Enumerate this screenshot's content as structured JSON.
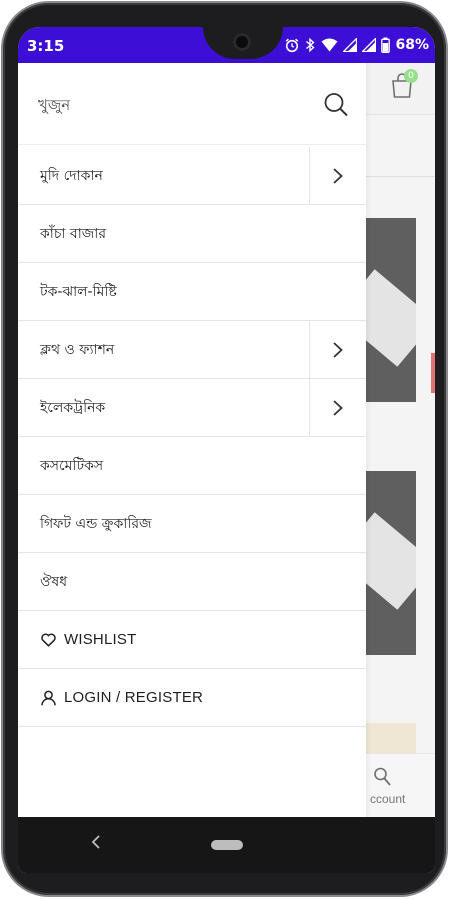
{
  "status_bar": {
    "time": "3:15",
    "battery_percent": "68%",
    "icons": [
      "alarm-icon",
      "bluetooth-icon",
      "wifi-icon",
      "signal-icon",
      "signal-icon",
      "battery-icon"
    ],
    "background_color": "#3d0fd6"
  },
  "background_app": {
    "cart_badge": "0",
    "bottom_nav_label": "ccount"
  },
  "drawer": {
    "search": {
      "placeholder": "খুজুন"
    },
    "menu": [
      {
        "label": "মুদি দোকান",
        "has_submenu": true
      },
      {
        "label": "কাঁচা বাজার",
        "has_submenu": false
      },
      {
        "label": "টক-ঝাল-মিষ্টি",
        "has_submenu": false
      },
      {
        "label": "ক্লথ ও ফ্যাশন",
        "has_submenu": true
      },
      {
        "label": "ইলেকট্রনিক",
        "has_submenu": true
      },
      {
        "label": "কসমেটিকস",
        "has_submenu": false
      },
      {
        "label": "গিফট এন্ড ক্রুকারিজ",
        "has_submenu": false
      },
      {
        "label": "ঔষধ",
        "has_submenu": false
      },
      {
        "label": "WISHLIST",
        "icon": "heart-icon"
      },
      {
        "label": "LOGIN / REGISTER",
        "icon": "user-icon"
      }
    ]
  }
}
